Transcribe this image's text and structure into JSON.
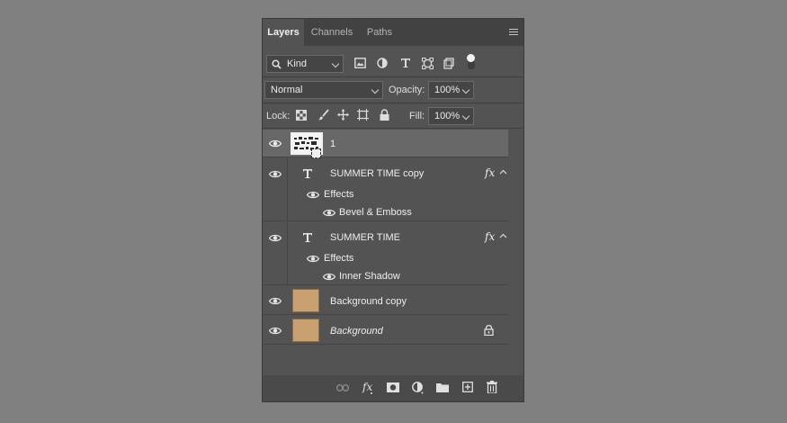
{
  "panel": {
    "tabs": [
      {
        "label": "Layers"
      },
      {
        "label": "Channels"
      },
      {
        "label": "Paths"
      }
    ]
  },
  "filter": {
    "kind_label": "Kind"
  },
  "blend": {
    "mode": "Normal",
    "opacity_label": "Opacity:",
    "opacity_value": "100%"
  },
  "lock": {
    "label": "Lock:",
    "fill_label": "Fill:",
    "fill_value": "100%"
  },
  "layers": [
    {
      "name": "1",
      "type": "image"
    },
    {
      "name": "SUMMER TIME copy",
      "type": "text",
      "fx": "fx",
      "effects_label": "Effects",
      "effect": "Bevel & Emboss"
    },
    {
      "name": "SUMMER TIME",
      "type": "text",
      "fx": "fx",
      "effects_label": "Effects",
      "effect": "Inner Shadow"
    },
    {
      "name": "Background copy",
      "type": "image"
    },
    {
      "name": "Background",
      "type": "image",
      "locked": true
    }
  ],
  "colors": {
    "panel_bg": "#535353",
    "selected_row": "#686868",
    "thumb_sand": "#c9a171"
  },
  "icons": {
    "footer": [
      "link-icon",
      "fx-icon",
      "mask-icon",
      "adjustment-icon",
      "folder-icon",
      "new-layer-icon",
      "trash-icon"
    ]
  }
}
